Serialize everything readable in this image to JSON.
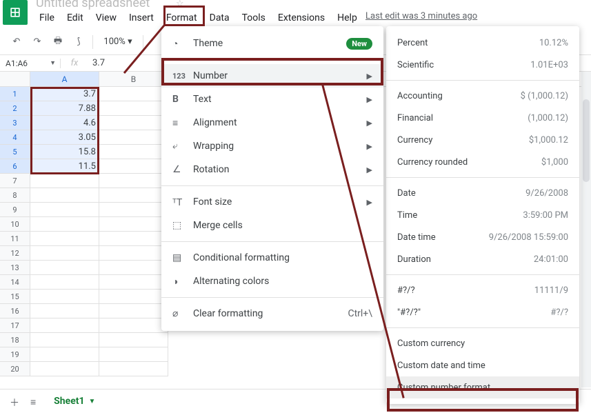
{
  "doc": {
    "title": "Untitled spreadsheet"
  },
  "last_edit": "Last edit was 3 minutes ago",
  "menu": {
    "file": "File",
    "edit": "Edit",
    "view": "View",
    "insert": "Insert",
    "format": "Format",
    "data": "Data",
    "tools": "Tools",
    "extensions": "Extensions",
    "help": "Help"
  },
  "toolbar": {
    "zoom": "100%"
  },
  "fbar": {
    "name": "A1:A6",
    "fx": "fx",
    "value": "3.7"
  },
  "cols": [
    "A",
    "B"
  ],
  "rows": [
    "1",
    "2",
    "3",
    "4",
    "5",
    "6",
    "7",
    "8",
    "9",
    "10",
    "11",
    "12",
    "13",
    "14",
    "15",
    "16",
    "17",
    "18",
    "19",
    "20"
  ],
  "cells": {
    "A1": "3.7",
    "A2": "7.88",
    "A3": "4.6",
    "A4": "3.05",
    "A5": "15.8",
    "A6": "11.5"
  },
  "format_menu": {
    "theme": "Theme",
    "new": "New",
    "number": "Number",
    "text": "Text",
    "alignment": "Alignment",
    "wrapping": "Wrapping",
    "rotation": "Rotation",
    "fontsize": "Font size",
    "merge": "Merge cells",
    "cond": "Conditional formatting",
    "alt": "Alternating colors",
    "clear": "Clear formatting",
    "clear_sc": "Ctrl+\\"
  },
  "number_menu": {
    "percent": {
      "l": "Percent",
      "v": "10.12%"
    },
    "scientific": {
      "l": "Scientific",
      "v": "1.01E+03"
    },
    "accounting": {
      "l": "Accounting",
      "v": "$ (1,000.12)"
    },
    "financial": {
      "l": "Financial",
      "v": "(1,000.12)"
    },
    "currency": {
      "l": "Currency",
      "v": "$1,000.12"
    },
    "currency_r": {
      "l": "Currency rounded",
      "v": "$1,000"
    },
    "date": {
      "l": "Date",
      "v": "9/26/2008"
    },
    "time": {
      "l": "Time",
      "v": "3:59:00 PM"
    },
    "datetime": {
      "l": "Date time",
      "v": "9/26/2008 15:59:00"
    },
    "duration": {
      "l": "Duration",
      "v": "24:01:00"
    },
    "frac1": {
      "l": "#?/?",
      "v": "11111/9"
    },
    "frac2": {
      "l": "\"#?/?\"",
      "v": "#?/?"
    },
    "cust_curr": "Custom currency",
    "cust_dt": "Custom date and time",
    "cust_num": "Custom number format"
  },
  "sheetbar": {
    "sheet1": "Sheet1"
  }
}
